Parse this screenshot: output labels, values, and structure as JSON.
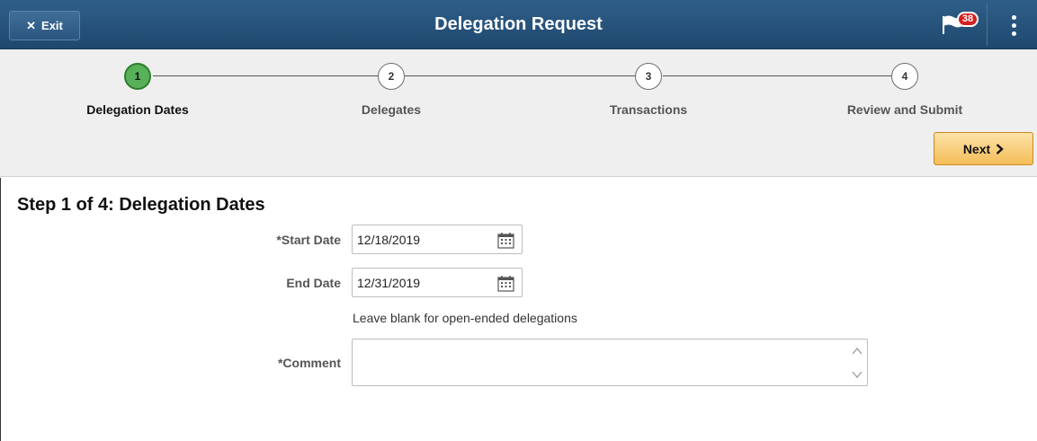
{
  "header": {
    "exit_label": "Exit",
    "title": "Delegation Request",
    "notification_count": "38"
  },
  "train": {
    "steps": [
      {
        "number": "1",
        "label": "Delegation Dates",
        "active": true
      },
      {
        "number": "2",
        "label": "Delegates",
        "active": false
      },
      {
        "number": "3",
        "label": "Transactions",
        "active": false
      },
      {
        "number": "4",
        "label": "Review and Submit",
        "active": false
      }
    ],
    "next_label": "Next"
  },
  "form": {
    "step_title": "Step 1 of 4: Delegation Dates",
    "start_date_label": "*Start Date",
    "start_date_value": "12/18/2019",
    "end_date_label": "End Date",
    "end_date_value": "12/31/2019",
    "hint": "Leave blank for open-ended delegations",
    "comment_label": "*Comment",
    "comment_value": ""
  },
  "colors": {
    "header_bg": "#2a5580",
    "active_step": "#58b158",
    "next_button": "#f4bd58",
    "badge": "#d32020"
  },
  "icons": [
    "close-icon",
    "flag-icon",
    "more-vertical-icon",
    "chevron-right-icon",
    "calendar-icon"
  ]
}
